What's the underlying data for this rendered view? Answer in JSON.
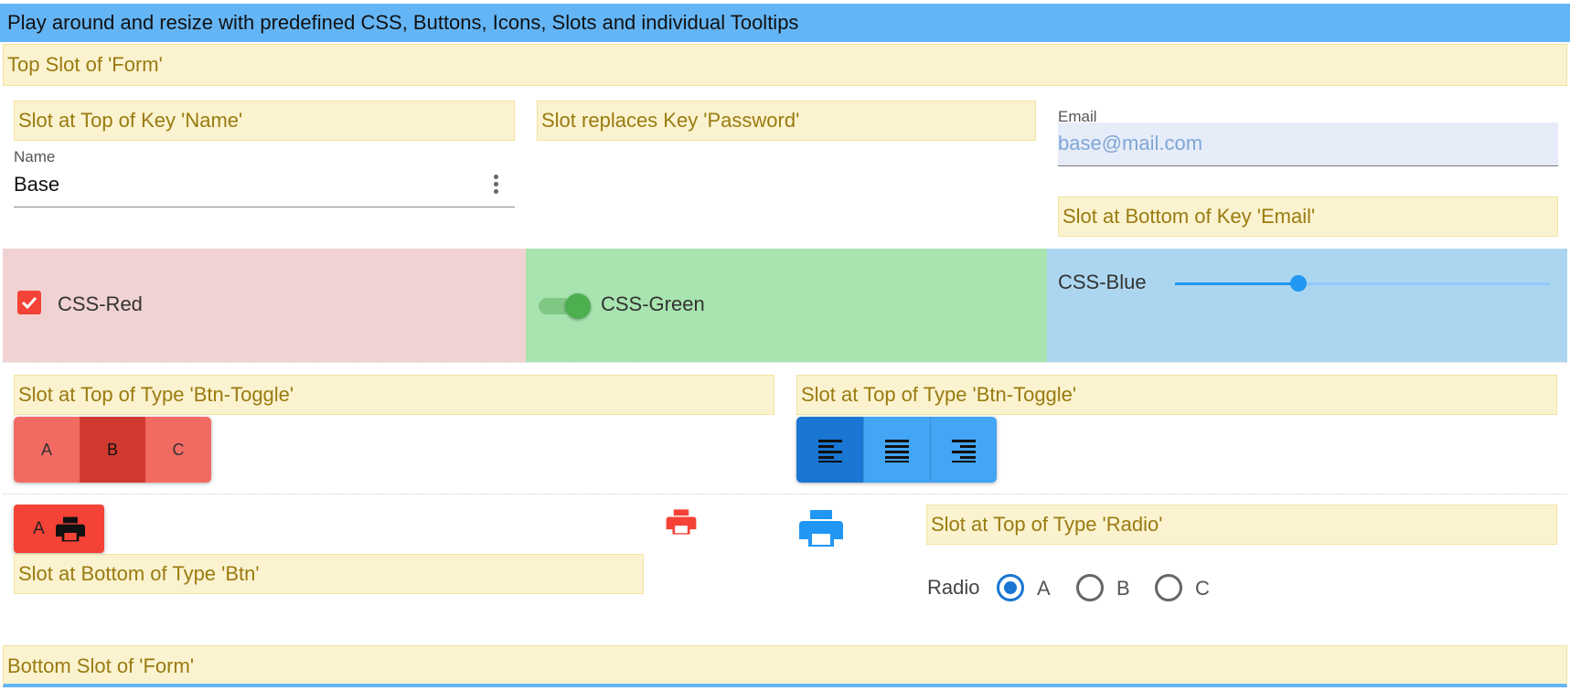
{
  "header": {
    "title": "Play around and resize with predefined CSS, Buttons, Icons, Slots and individual Tooltips"
  },
  "slots": {
    "top_form": "Top Slot of 'Form'",
    "top_name": "Slot at Top of Key 'Name'",
    "replace_password": "Slot replaces Key 'Password'",
    "bottom_email": "Slot at Bottom of Key 'Email'",
    "top_btn_toggle_left": "Slot at Top of Type 'Btn-Toggle'",
    "top_btn_toggle_right": "Slot at Top of Type 'Btn-Toggle'",
    "bottom_btn": "Slot at Bottom of Type 'Btn'",
    "top_radio": "Slot at Top of Type 'Radio'",
    "bottom_form": "Bottom Slot of 'Form'"
  },
  "fields": {
    "name": {
      "label": "Name",
      "value": "Base",
      "menu_icon": "dots-vertical-icon"
    },
    "email": {
      "label": "Email",
      "value": "base@mail.com"
    }
  },
  "css_red": {
    "label": "CSS-Red",
    "checked": true,
    "color": "#f44336"
  },
  "css_green": {
    "label": "CSS-Green",
    "on": true,
    "color": "#4caf50"
  },
  "css_blue": {
    "label": "CSS-Blue",
    "value_fraction": 0.33,
    "color": "#2196f3"
  },
  "toggle_red": {
    "options": [
      "A",
      "B",
      "C"
    ],
    "selected": "B"
  },
  "toggle_align": {
    "options": [
      "format-align-left-icon",
      "format-align-justify-icon",
      "format-align-right-icon"
    ],
    "selected": 0
  },
  "buttons": {
    "a_button": {
      "label": "A",
      "icon": "printer-icon",
      "color": "#f44336"
    },
    "print_red": {
      "icon": "printer-icon",
      "color": "#f44336"
    },
    "print_blue": {
      "icon": "printer-icon",
      "color": "#2196f3"
    }
  },
  "radio": {
    "label": "Radio",
    "options": [
      "A",
      "B",
      "C"
    ],
    "selected": "A"
  }
}
